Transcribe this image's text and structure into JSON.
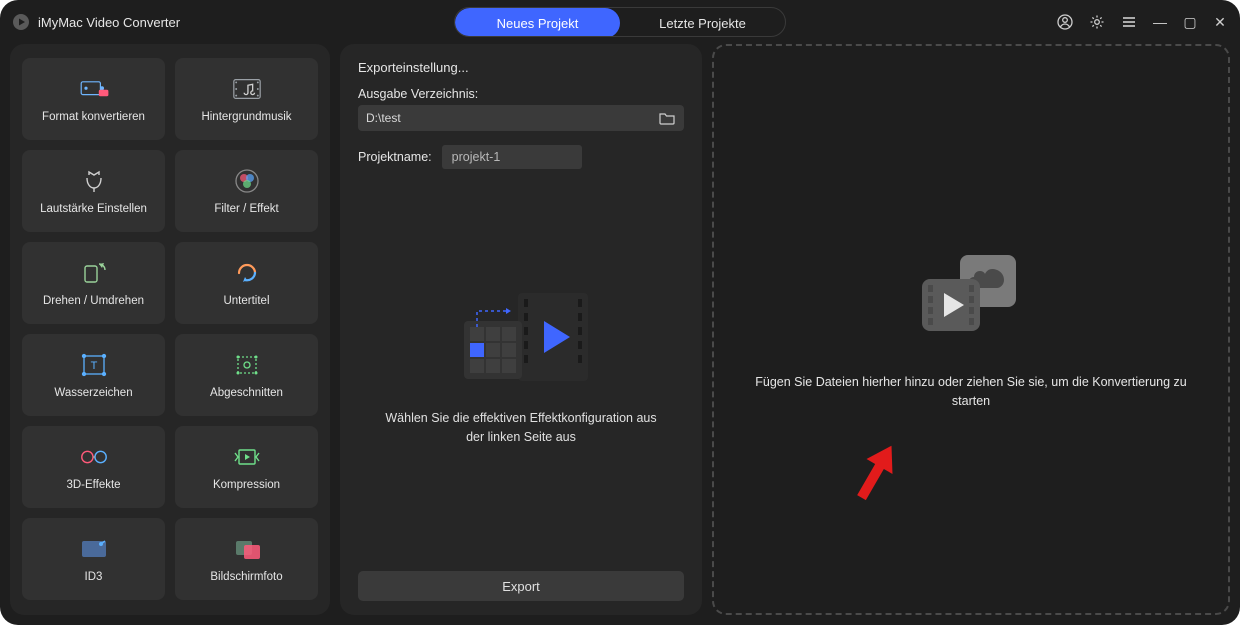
{
  "app": {
    "title": "iMyMac Video Converter"
  },
  "tabs": {
    "new": "Neues Projekt",
    "recent": "Letzte Projekte"
  },
  "sidebar": {
    "items": [
      {
        "label": "Format konvertieren"
      },
      {
        "label": "Hintergrundmusik"
      },
      {
        "label": "Lautstärke Einstellen"
      },
      {
        "label": "Filter / Effekt"
      },
      {
        "label": "Drehen / Umdrehen"
      },
      {
        "label": "Untertitel"
      },
      {
        "label": "Wasserzeichen"
      },
      {
        "label": "Abgeschnitten"
      },
      {
        "label": "3D-Effekte"
      },
      {
        "label": "Kompression"
      },
      {
        "label": "ID3"
      },
      {
        "label": "Bildschirmfoto"
      }
    ]
  },
  "center": {
    "heading": "Exporteinstellung...",
    "outdir_label": "Ausgabe Verzeichnis:",
    "outdir_value": "D:\\test",
    "projectname_label": "Projektname:",
    "projectname_value": "projekt-1",
    "hint": "Wählen Sie die effektiven Effektkonfiguration aus der linken Seite aus",
    "export_label": "Export"
  },
  "right": {
    "hint": "Fügen Sie Dateien hierher hinzu oder ziehen Sie sie, um die Konvertierung zu starten"
  }
}
